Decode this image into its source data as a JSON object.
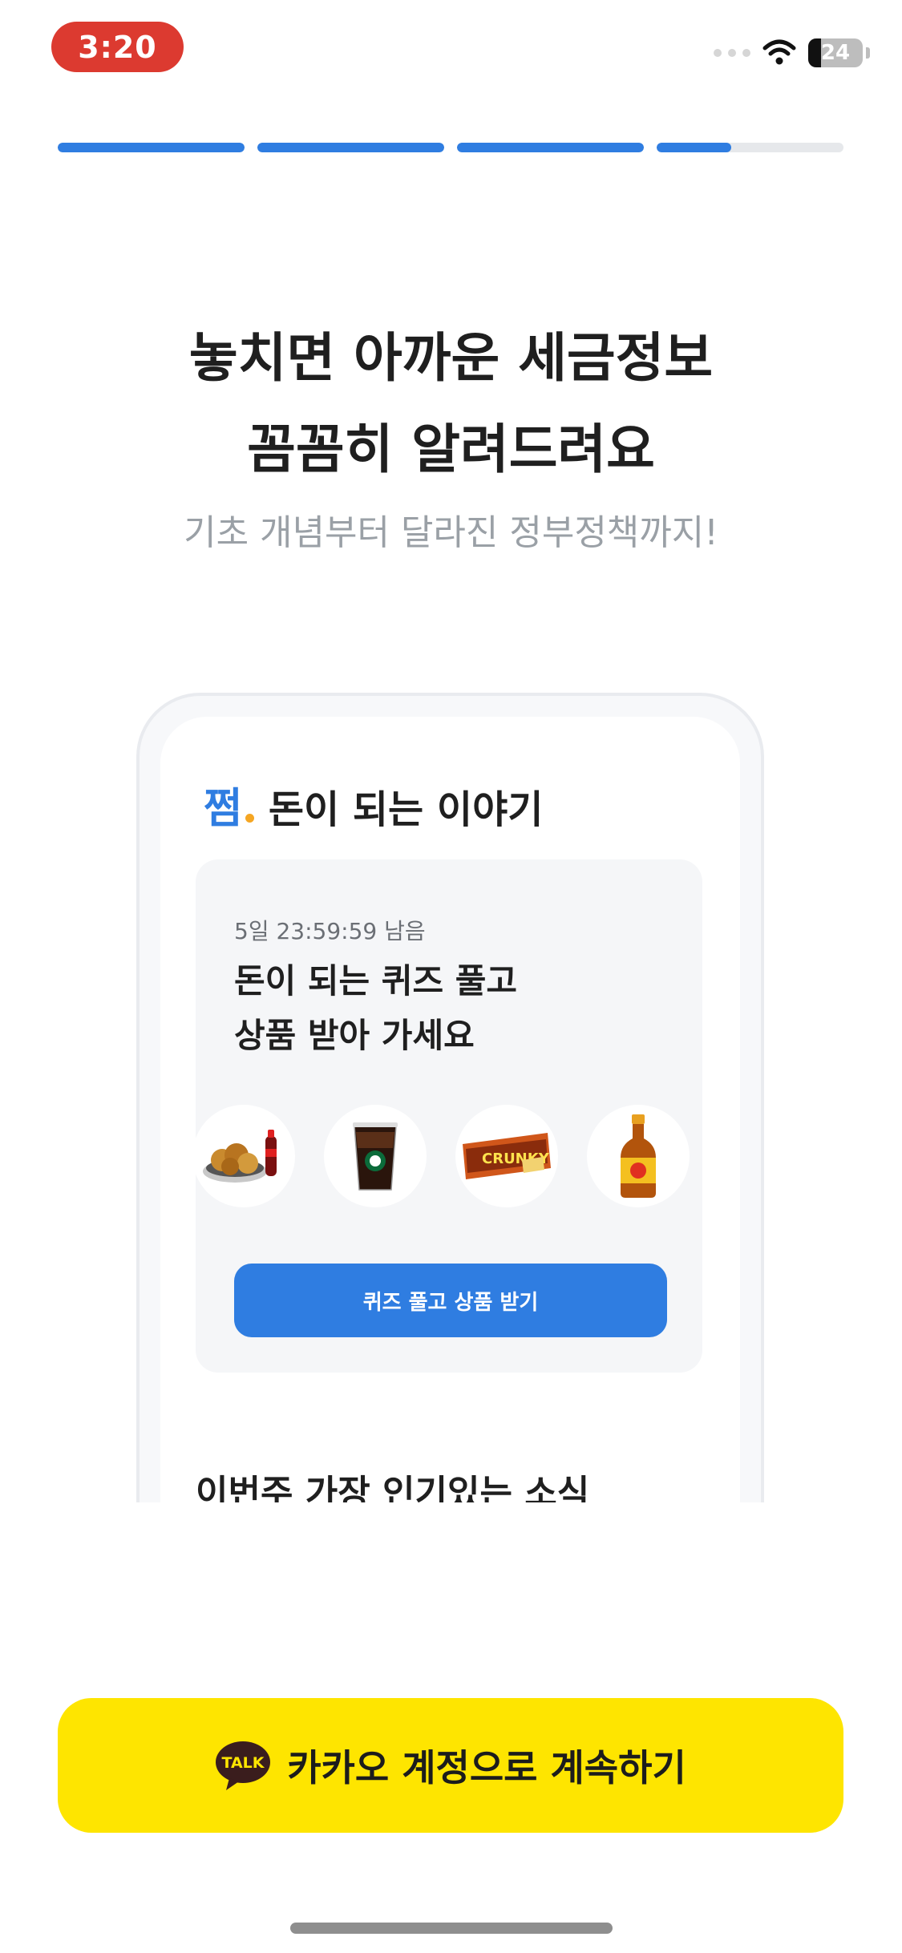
{
  "status_bar": {
    "time": "3:20",
    "battery_level": "24",
    "battery_fraction": 0.24
  },
  "onboarding": {
    "steps_total": 4,
    "step_fill_fractions": [
      1,
      1,
      1,
      0.4
    ]
  },
  "headline": {
    "line1": "놓치면 아까운 세금정보",
    "line2": "꼼꼼히 알려드려요",
    "subtitle": "기초 개념부터 달라진 정부정책까지!"
  },
  "preview": {
    "brand": "쩜",
    "section_title": "돈이 되는 이야기",
    "quiz": {
      "timer": "5일 23:59:59 남음",
      "title_line1": "돈이 되는 퀴즈 풀고",
      "title_line2": "상품 받아 가세요",
      "prizes": [
        "chicken-and-cola-icon",
        "iced-coffee-icon",
        "chocolate-bar-icon",
        "energy-drink-bottle-icon"
      ],
      "button_label": "퀴즈 풀고 상품 받기"
    },
    "popular_title": "이번주 가장 인기있는 소식"
  },
  "cta": {
    "kakao_badge": "TALK",
    "kakao_label": "카카오 계정으로 계속하기"
  },
  "colors": {
    "accent": "#2f7de1",
    "kakao_yellow": "#fee500",
    "time_pill": "#dc3a30"
  }
}
